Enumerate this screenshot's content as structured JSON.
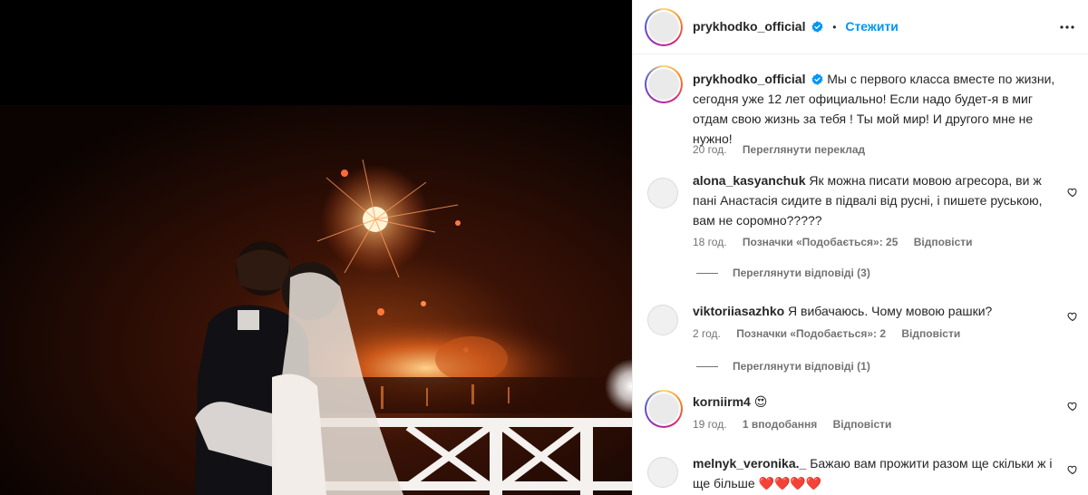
{
  "post_author": {
    "username": "prykhodko_official",
    "follow_label": "Стежити",
    "separator": "•"
  },
  "caption": {
    "username": "prykhodko_official",
    "text": "Мы с первого класса вместе по жизни, сегодня уже 12 лет официально! Если надо будет-я в миг отдам свою жизнь за тебя ! Ты мой мир! И другого мне не нужно!",
    "time": "20 год.",
    "translate_label": "Переглянути переклад"
  },
  "comments": [
    {
      "username": "alona_kasyanchuk",
      "text": "Як можна писати мовою агресора, ви ж пані Анастасія сидите в підвалі від русні, і пишете руською, вам не соромно?????",
      "time": "18 год.",
      "likes": "Позначки «Подобається»: 25",
      "reply_label": "Відповісти",
      "view_replies": "Переглянути відповіді (3)"
    },
    {
      "username": "viktoriiasazhko",
      "text": "Я вибачаюсь. Чому мовою рашки?",
      "time": "2 год.",
      "likes": "Позначки «Подобається»: 2",
      "reply_label": "Відповісти",
      "view_replies": "Переглянути відповіді (1)"
    },
    {
      "username": "korniirm4",
      "text": "😍",
      "time": "19 год.",
      "likes": "1 вподобання",
      "reply_label": "Відповісти"
    },
    {
      "username": "melnyk_veronika._",
      "text": "Бажаю вам прожити разом ще скільки ж і ще більше",
      "hearts": "❤️❤️❤️❤️"
    }
  ],
  "colors": {
    "accent": "#0095f6",
    "muted": "#737373",
    "verified": "#0095f6"
  },
  "icons": {
    "verified": "verified-badge-icon",
    "more": "more-options-icon",
    "like": "heart-outline-icon"
  }
}
